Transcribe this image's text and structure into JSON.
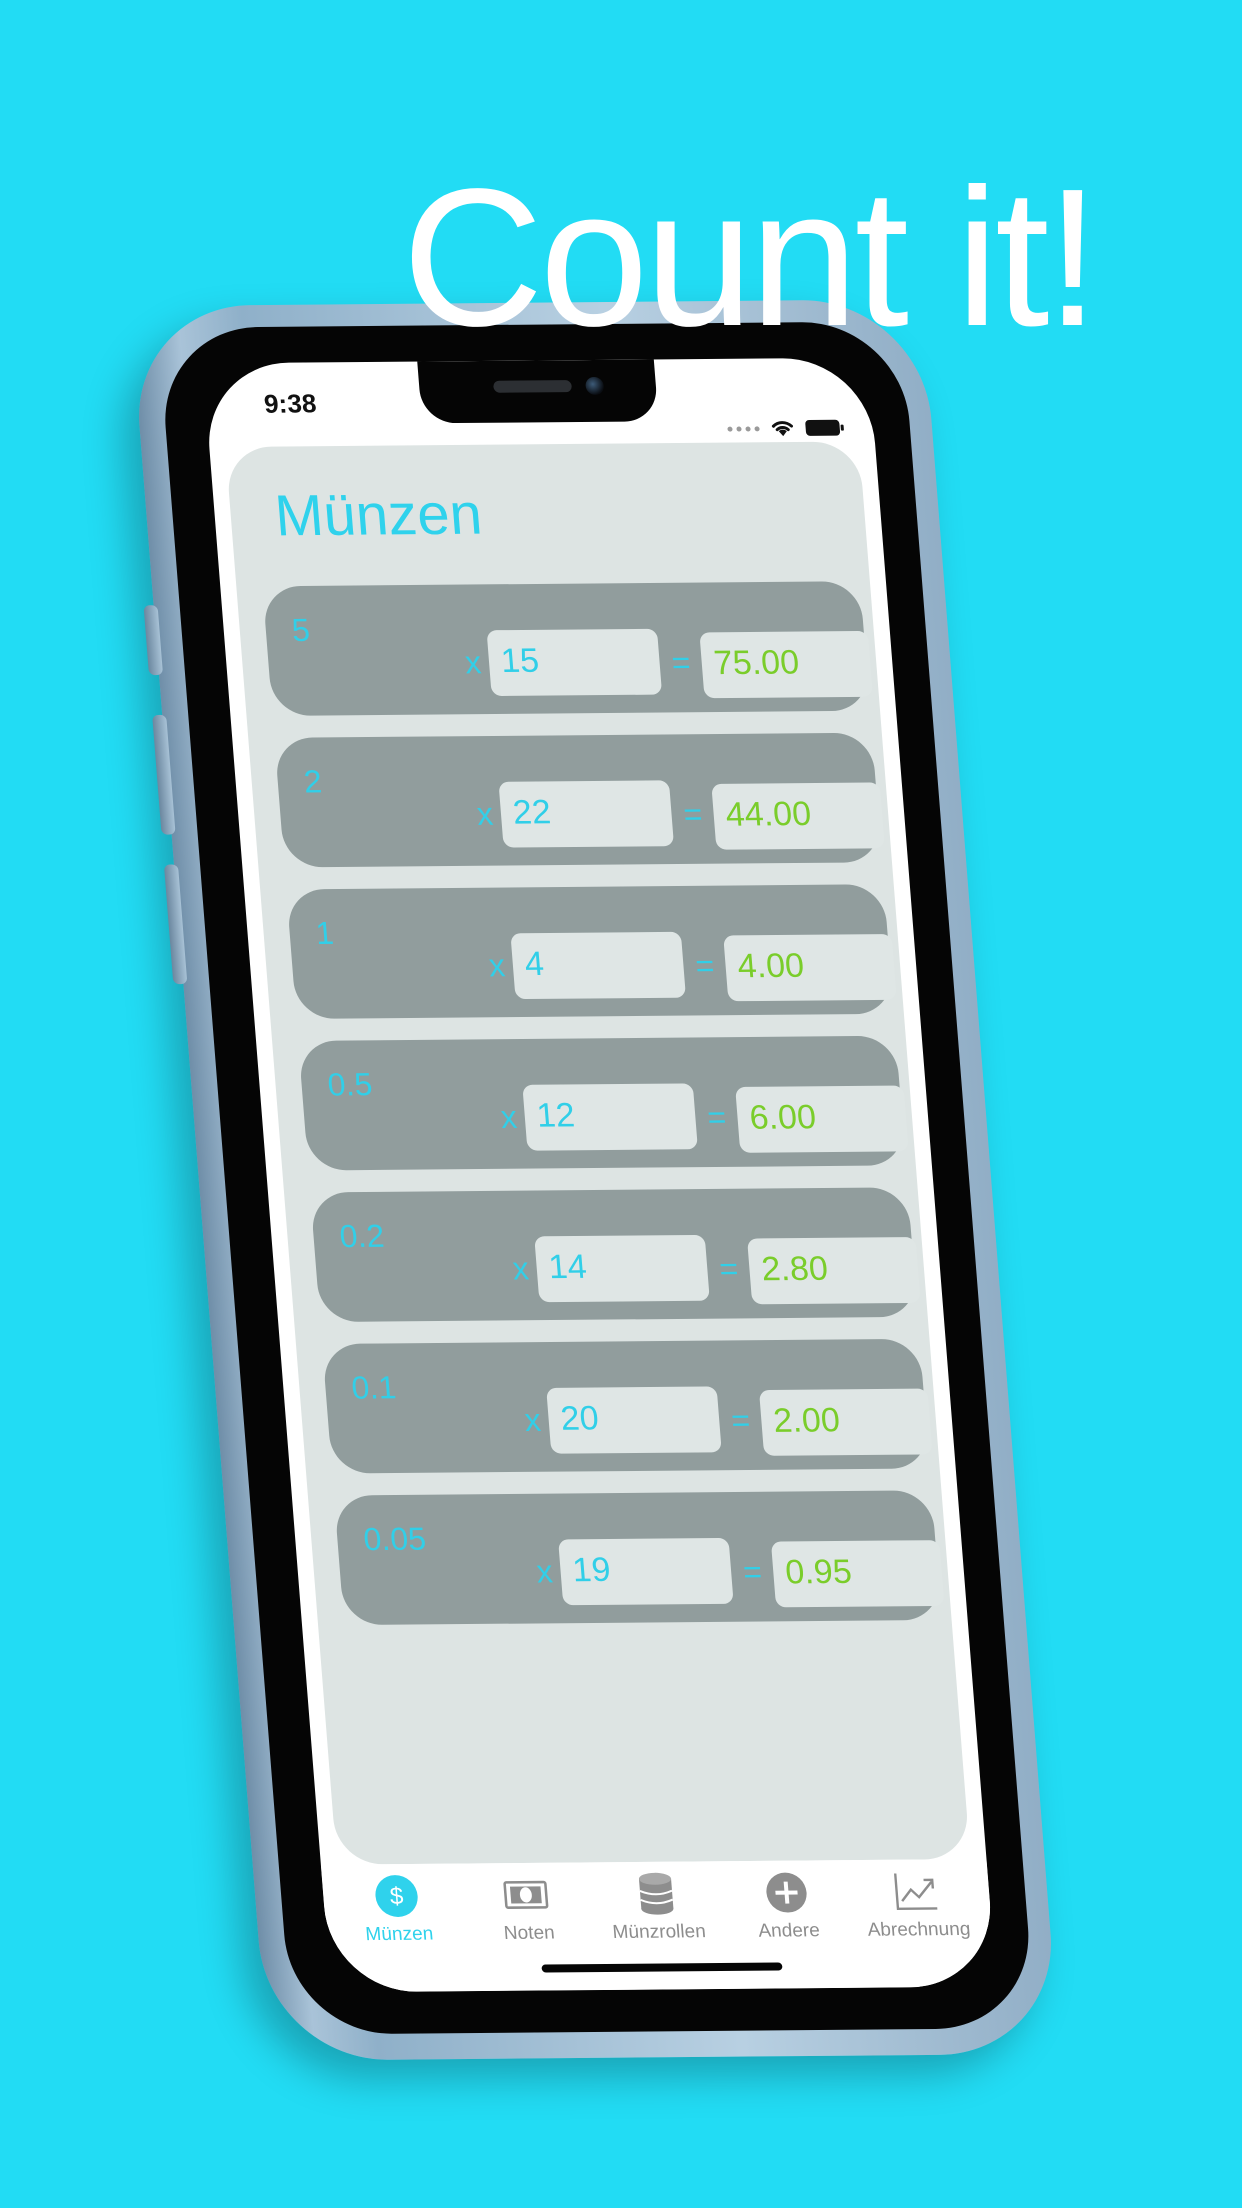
{
  "promo": {
    "headline": "Count it!"
  },
  "status_bar": {
    "time": "9:38"
  },
  "screen": {
    "title": "Münzen",
    "multiply_symbol": "x",
    "equals_symbol": "=",
    "rows": [
      {
        "denomination": "5",
        "quantity": "15",
        "total": "75.00"
      },
      {
        "denomination": "2",
        "quantity": "22",
        "total": "44.00"
      },
      {
        "denomination": "1",
        "quantity": "4",
        "total": "4.00"
      },
      {
        "denomination": "0.5",
        "quantity": "12",
        "total": "6.00"
      },
      {
        "denomination": "0.2",
        "quantity": "14",
        "total": "2.80"
      },
      {
        "denomination": "0.1",
        "quantity": "20",
        "total": "2.00"
      },
      {
        "denomination": "0.05",
        "quantity": "19",
        "total": "0.95"
      }
    ]
  },
  "tab_bar": {
    "tabs": [
      {
        "label": "Münzen",
        "icon": "dollar-circle-icon",
        "active": true
      },
      {
        "label": "Noten",
        "icon": "banknote-icon",
        "active": false
      },
      {
        "label": "Münzrollen",
        "icon": "coin-roll-icon",
        "active": false
      },
      {
        "label": "Andere",
        "icon": "plus-circle-icon",
        "active": false
      },
      {
        "label": "Abrechnung",
        "icon": "chart-trend-icon",
        "active": false
      }
    ]
  },
  "colors": {
    "background": "#22dcf4",
    "accent": "#2fd2ec",
    "total_text": "#7acd2b",
    "row_background": "#919d9d",
    "sheet_background": "#dde4e3"
  }
}
